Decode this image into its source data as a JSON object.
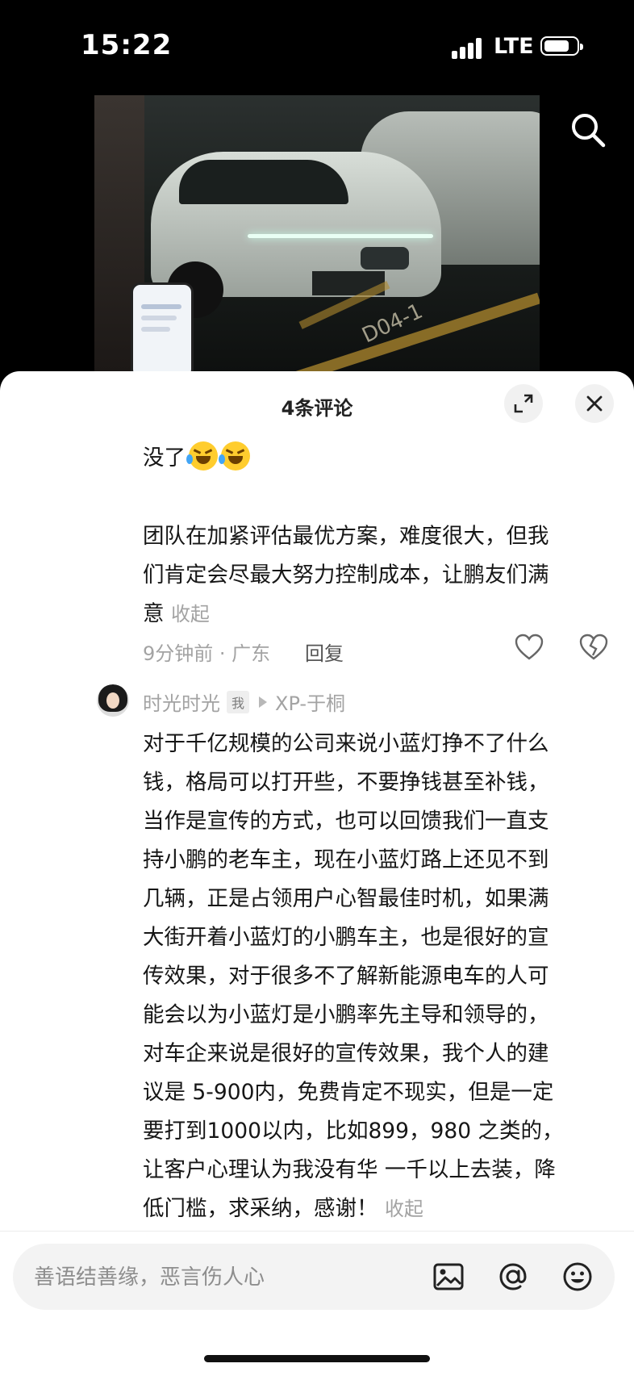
{
  "status_bar": {
    "time": "15:22",
    "network": "LTE"
  },
  "sheet": {
    "title": "4条评论"
  },
  "comment1": {
    "line1_text": "没了",
    "paragraph_lines": [
      "团队在加紧评估最优方案，难度很大，但我",
      "们肯定会尽最大努力控制成本，让鹏友们满",
      "意"
    ],
    "collapse_label": "收起",
    "meta": "9分钟前 · 广东",
    "reply_label": "回复"
  },
  "comment2": {
    "author": "时光时光",
    "me_tag": "我",
    "reply_to": "XP-于桐",
    "lines": [
      "对于千亿规模的公司来说小蓝灯挣不了什么",
      "钱，格局可以打开些，不要挣钱甚至补钱，",
      "当作是宣传的方式，也可以回馈我们一直支",
      "持小鹏的老车主，现在小蓝灯路上还见不到",
      "几辆，正是占领用户心智最佳时机，如果满",
      "大街开着小蓝灯的小鹏车主，也是很好的宣",
      "传效果，对于很多不了解新能源电车的人可",
      "能会以为小蓝灯是小鹏率先主导和领导的，",
      "对车企来说是很好的宣传效果，我个人的建",
      "议是 5-900内，免费肯定不现实，但是一定",
      "要打到1000以内，比如899，980 之类的，",
      "让客户心理认为我没有华 一千以上去装，降",
      "低门槛，求采纳，感谢！"
    ],
    "collapse_label": "收起"
  },
  "input": {
    "placeholder": "善语结善缘，恶言伤人心"
  },
  "video": {
    "floor_code": "D04-1"
  }
}
